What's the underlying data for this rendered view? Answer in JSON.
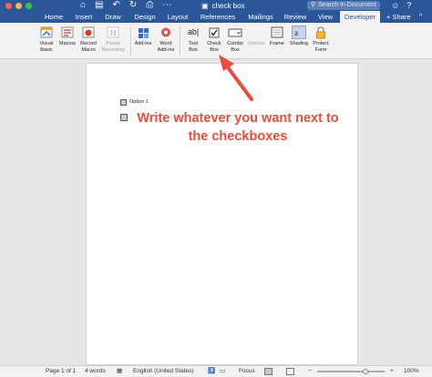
{
  "window": {
    "title": "check box",
    "search_placeholder": "Search in Document",
    "share_label": "Share"
  },
  "quick_access": {
    "icons": [
      "home-icon",
      "save-icon",
      "undo-icon",
      "redo-icon",
      "print-icon"
    ]
  },
  "tabs": [
    {
      "label": "Home",
      "active": false
    },
    {
      "label": "Insert",
      "active": false
    },
    {
      "label": "Draw",
      "active": false
    },
    {
      "label": "Design",
      "active": false
    },
    {
      "label": "Layout",
      "active": false
    },
    {
      "label": "References",
      "active": false
    },
    {
      "label": "Mailings",
      "active": false
    },
    {
      "label": "Review",
      "active": false
    },
    {
      "label": "View",
      "active": false
    },
    {
      "label": "Developer",
      "active": true
    }
  ],
  "ribbon": {
    "visual_basic": "Visual\nBasic",
    "macros": "Macros",
    "record_macro": "Record\nMacro",
    "pause_recording": "Pause\nRecording",
    "add_ins": "Add-ins",
    "word_add_ins": "Word\nAdd-ins",
    "text_box": "Text\nBox",
    "check_box": "Check\nBox",
    "combo_box": "Combo\nBox",
    "options": "Options",
    "frame": "Frame",
    "shading": "Shading",
    "protect_form": "Protect\nForm",
    "text_box_glyph": "ab|"
  },
  "document": {
    "option_label": "Option 1",
    "note_text": "Write whatever you want next to the checkboxes"
  },
  "status_bar": {
    "page": "Page 1 of 1",
    "words": "4 words",
    "language": "English (United States)",
    "focus": "Focus",
    "zoom": "100%"
  },
  "colors": {
    "brand_blue": "#2b579a",
    "annotation_red": "#e84c3d"
  }
}
